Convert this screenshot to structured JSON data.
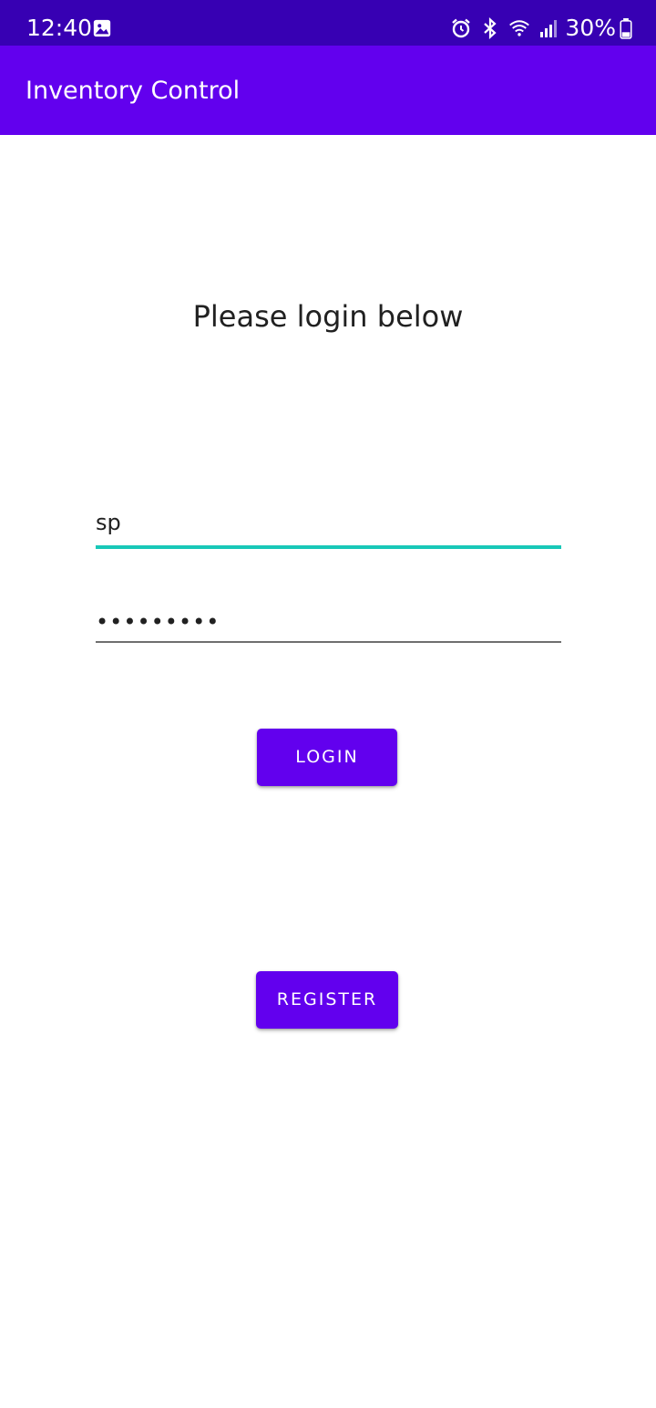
{
  "status_bar": {
    "time": "12:40",
    "battery_percent": "30%",
    "icons": [
      "gallery-icon",
      "alarm-icon",
      "bluetooth-icon",
      "wifi-icon",
      "signal-icon",
      "battery-icon"
    ],
    "background": "#3700b3"
  },
  "app_bar": {
    "title": "Inventory Control",
    "background": "#6200ee"
  },
  "login": {
    "prompt": "Please login below",
    "username_value": "sp",
    "password_masked": "•••••••••",
    "login_label": "LOGIN",
    "register_label": "REGISTER",
    "accent_color": "#6200ee",
    "focused_underline_color": "#18c8b8"
  }
}
